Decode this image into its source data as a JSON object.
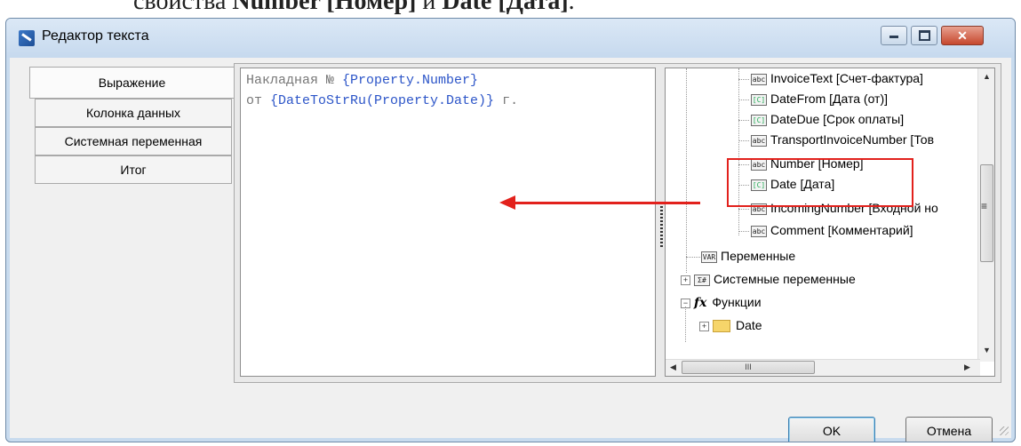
{
  "doc_caption": {
    "prefix": "свойства ",
    "bold1": "Number [Номер]",
    "mid": " и ",
    "bold2": "Date [Дата]",
    "suffix": "."
  },
  "window": {
    "title": "Редактор текста"
  },
  "tabs": [
    {
      "label": "Выражение",
      "active": true
    },
    {
      "label": "Колонка данных"
    },
    {
      "label": "Системная переменная"
    },
    {
      "label": "Итог"
    }
  ],
  "editor": {
    "line1_plain": "Накладная № ",
    "line1_expr": "{Property.Number}",
    "line2_plain": "от ",
    "line2_expr": "{DateToStrRu(Property.Date)}",
    "line2_tail": " г."
  },
  "tree": {
    "items": [
      {
        "label": "InvoiceText [Счет-фактура]",
        "icon": "abc"
      },
      {
        "label": "DateFrom [Дата (от)]",
        "icon": "date"
      },
      {
        "label": "DateDue [Срок оплаты]",
        "icon": "date"
      },
      {
        "label": "TransportInvoiceNumber [Тов",
        "icon": "abc"
      },
      {
        "label": "Number [Номер]",
        "icon": "abc"
      },
      {
        "label": "Date [Дата]",
        "icon": "date"
      },
      {
        "label": "IncomingNumber [Входной но",
        "icon": "abc"
      },
      {
        "label": "Comment [Комментарий]",
        "icon": "abc"
      }
    ],
    "variables": "Переменные",
    "system_variables": "Системные переменные",
    "functions": "Функции",
    "date_folder": "Date",
    "icon_labels": {
      "abc": "abc",
      "date": "[C]",
      "var": "VAR",
      "sys": "Σ#"
    },
    "hscroll_label": "III",
    "vscroll_middle": "≡"
  },
  "buttons": {
    "ok": "OK",
    "cancel": "Отмена"
  }
}
